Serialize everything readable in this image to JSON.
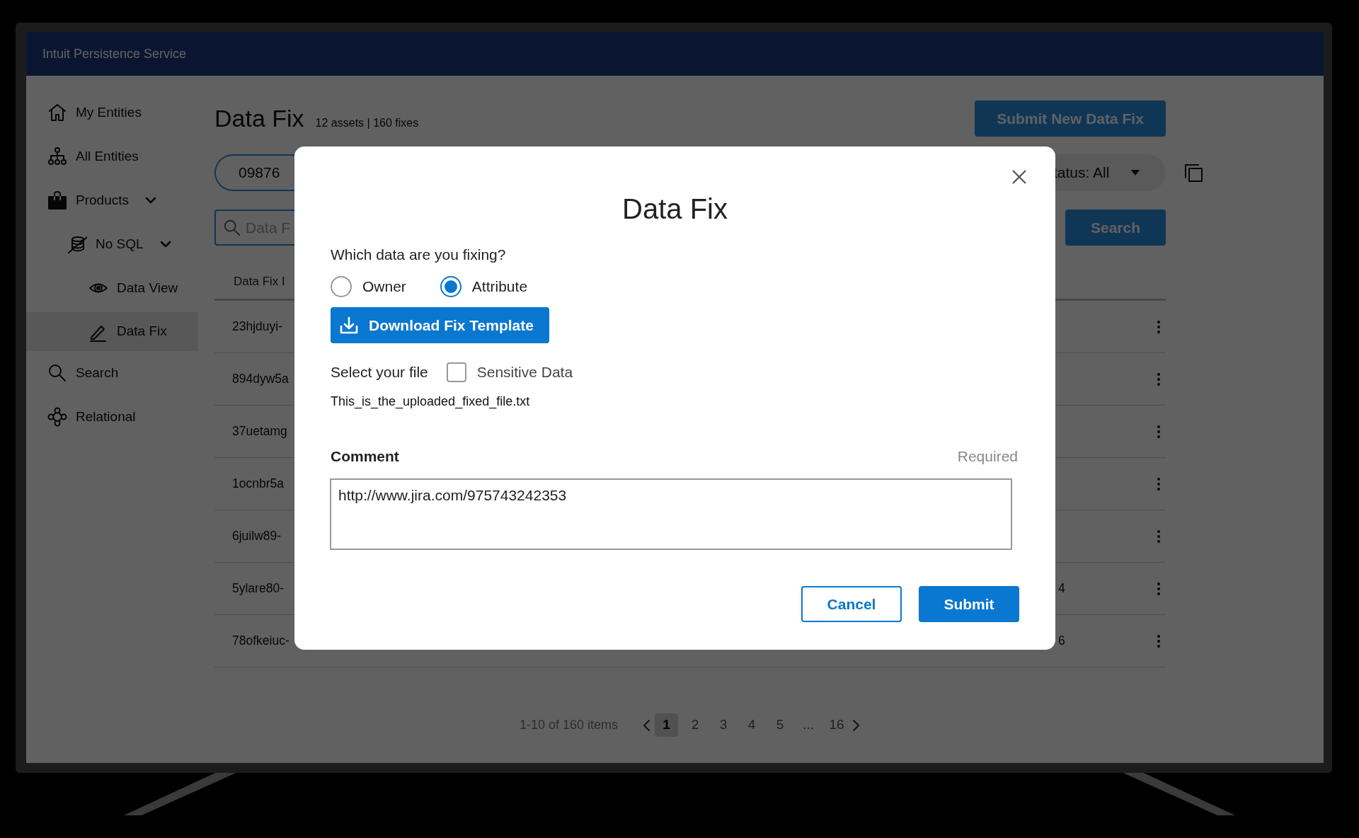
{
  "app": {
    "title": "Intuit Persistence Service"
  },
  "sidebar": {
    "items": [
      {
        "label": "My Entities",
        "selected": false
      },
      {
        "label": "All Entities",
        "selected": false
      },
      {
        "label": "Products",
        "selected": false,
        "expanded": true,
        "children": [
          {
            "label": "No SQL",
            "selected": false,
            "expanded": true,
            "children": [
              {
                "label": "Data View",
                "selected": false
              },
              {
                "label": "Data Fix",
                "selected": true
              }
            ]
          }
        ]
      },
      {
        "label": "Search",
        "selected": false
      },
      {
        "label": "Relational",
        "selected": false
      }
    ]
  },
  "page": {
    "title": "Data Fix",
    "summary": "12 assets | 160 fixes",
    "new_button": "Submit New Data Fix",
    "id_filter": "09876",
    "status_filter": "tatus: All",
    "search_placeholder": "Data F",
    "search_button": "Search"
  },
  "table": {
    "columns": [
      "Data Fix I"
    ],
    "rows": [
      {
        "cell_1": "23hjduyi-"
      },
      {
        "cell_1": "894dyw5a"
      },
      {
        "cell_1": "37uetamg"
      },
      {
        "cell_1": "1ocnbr5a"
      },
      {
        "cell_1": "6juilw89-"
      },
      {
        "cell_1": "5ylare80-",
        "right_cell": "4"
      },
      {
        "cell_1": "78ofkeiuc-",
        "right_cell": "6"
      }
    ]
  },
  "pagination": {
    "summary": "1-10 of 160 items",
    "pages": [
      {
        "label": "1",
        "kind": "page",
        "selected": true
      },
      {
        "label": "2",
        "kind": "page",
        "selected": false
      },
      {
        "label": "3",
        "kind": "page",
        "selected": false
      },
      {
        "label": "4",
        "kind": "page",
        "selected": false
      },
      {
        "label": "5",
        "kind": "page",
        "selected": false
      },
      {
        "label": "...",
        "kind": "ellipsis"
      },
      {
        "label": "16",
        "kind": "page",
        "selected": false
      }
    ]
  },
  "modal": {
    "title": "Data Fix",
    "question": "Which data are you fixing?",
    "options": [
      {
        "label": "Owner",
        "selected": false
      },
      {
        "label": "Attribute",
        "selected": true
      }
    ],
    "download_button": "Download Fix Template",
    "file_label": "Select your file",
    "sensitive": {
      "label": "Sensitive Data",
      "checked": false
    },
    "file_name": "This_is_the_uploaded_fixed_file.txt",
    "comment": {
      "label": "Comment",
      "hint": "Required",
      "value": "http://www.jira.com/975743242353"
    },
    "buttons": [
      {
        "label": "Cancel",
        "kind": "secondary"
      },
      {
        "label": "Submit",
        "kind": "primary"
      }
    ]
  }
}
